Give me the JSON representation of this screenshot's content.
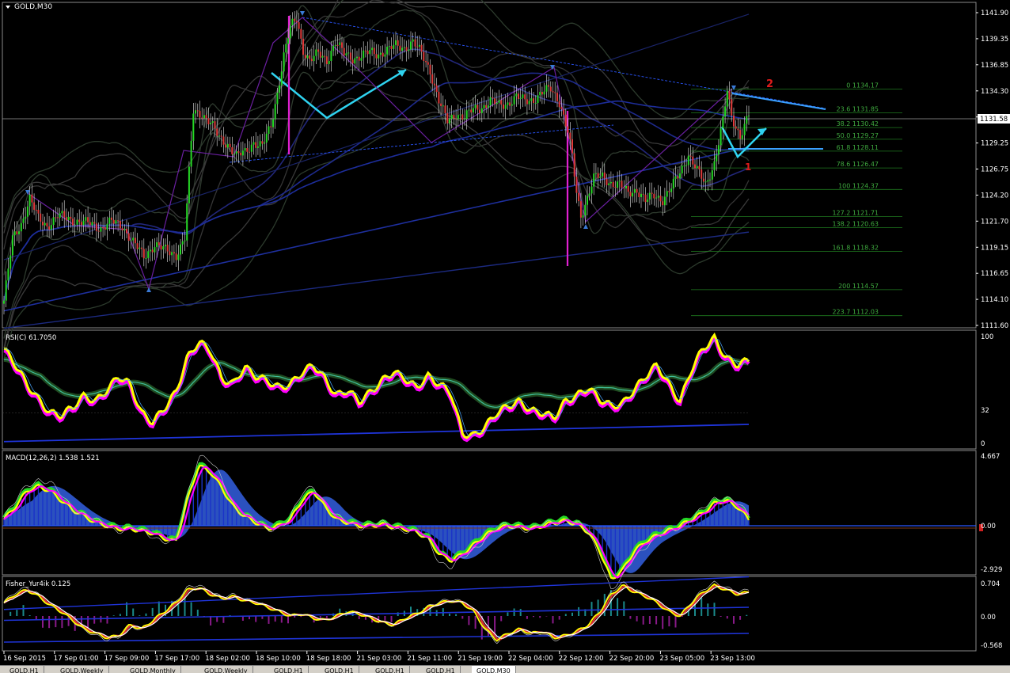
{
  "window": {
    "title": "GOLD,M30"
  },
  "colors": {
    "background": "#000000",
    "bull": "#26d926",
    "bear": "#e03a3a",
    "rsi_line": "#ffff00",
    "rsi_shadow": "#ff00ff",
    "macd_hist": "#1f3fd8",
    "macd_fill": "#3a6cff",
    "fibo": "#1f7a1f",
    "arrow": "#2fd3f0",
    "wave_label": "#e01b1b",
    "vertical_marker": "#e020d0"
  },
  "price_axis": {
    "ticks": [
      "1141.90",
      "1139.35",
      "1136.85",
      "1134.30",
      "1131.85",
      "1129.25",
      "1126.75",
      "1124.20",
      "1121.70",
      "1119.15",
      "1116.65",
      "1114.10",
      "1111.60"
    ],
    "current": "1131.58"
  },
  "time_axis": {
    "ticks": [
      "16 Sep 2015",
      "17 Sep 01:00",
      "17 Sep 09:00",
      "17 Sep 17:00",
      "18 Sep 02:00",
      "18 Sep 10:00",
      "18 Sep 18:00",
      "21 Sep 03:00",
      "21 Sep 11:00",
      "21 Sep 19:00",
      "22 Sep 04:00",
      "22 Sep 12:00",
      "22 Sep 20:00",
      "23 Sep 05:00",
      "23 Sep 13:00"
    ]
  },
  "fibo_levels": [
    {
      "label": "0 1134.17",
      "price": 1134.17
    },
    {
      "label": "23.6 1131.85",
      "price": 1131.85
    },
    {
      "label": "38.2 1130.42",
      "price": 1130.42
    },
    {
      "label": "50.0 1129.27",
      "price": 1129.27
    },
    {
      "label": "61.8 1128.11",
      "price": 1128.11
    },
    {
      "label": "78.6 1126.47",
      "price": 1126.47
    },
    {
      "label": "100 1124.37",
      "price": 1124.37
    },
    {
      "label": "127.2 1121.71",
      "price": 1121.71
    },
    {
      "label": "138.2 1120.63",
      "price": 1120.63
    },
    {
      "label": "161.8 1118.32",
      "price": 1118.32
    },
    {
      "label": "200 1114.57",
      "price": 1114.57
    },
    {
      "label": "223.7 1112.03",
      "price": 1112.03
    }
  ],
  "wave_labels": [
    "2",
    "1"
  ],
  "indicators": {
    "rsi": {
      "label": "RSI(C) 61.7050",
      "axis": [
        "100",
        "32",
        "0"
      ]
    },
    "macd": {
      "label": "MACD(12,26,2) 1.538 1.521",
      "axis": [
        "4.667",
        "0.00",
        "-2.929"
      ]
    },
    "sub4": {
      "label": "Fisher_Yur4ik 0.125",
      "axis": [
        "0.704",
        "0.00",
        "-0.568"
      ]
    }
  },
  "tabs": [
    "GOLD,H1",
    "GOLD,Weekly",
    "GOLD,Monthly",
    "GOLD,Weekly",
    "GOLD,H1",
    "GOLD,H1",
    "GOLD,H1",
    "GOLD,H1",
    "GOLD,M30"
  ],
  "active_tab": 8,
  "chart_data": {
    "type": "candlestick",
    "title": "GOLD,M30",
    "ylim": [
      1111.0,
      1142.5
    ],
    "x_ticks": [
      "16 Sep 2015",
      "17 Sep 01:00",
      "17 Sep 09:00",
      "17 Sep 17:00",
      "18 Sep 02:00",
      "18 Sep 10:00",
      "18 Sep 18:00",
      "21 Sep 03:00",
      "21 Sep 11:00",
      "21 Sep 19:00",
      "22 Sep 04:00",
      "22 Sep 12:00",
      "22 Sep 20:00",
      "23 Sep 05:00",
      "23 Sep 13:00"
    ],
    "price_path": [
      [
        0,
        1113.5
      ],
      [
        4,
        1119.5
      ],
      [
        8,
        1121.0
      ],
      [
        12,
        1123.5
      ],
      [
        16,
        1121.5
      ],
      [
        20,
        1120.8
      ],
      [
        25,
        1121.8
      ],
      [
        30,
        1121.5
      ],
      [
        35,
        1121.2
      ],
      [
        40,
        1121.0
      ],
      [
        45,
        1120.6
      ],
      [
        50,
        1121.2
      ],
      [
        55,
        1120.8
      ],
      [
        60,
        1119.2
      ],
      [
        65,
        1117.8
      ],
      [
        70,
        1119.0
      ],
      [
        75,
        1118.4
      ],
      [
        80,
        1118.0
      ],
      [
        84,
        1119.6
      ],
      [
        86,
        1126.0
      ],
      [
        88,
        1132.0
      ],
      [
        92,
        1131.8
      ],
      [
        96,
        1130.8
      ],
      [
        100,
        1129.4
      ],
      [
        104,
        1128.8
      ],
      [
        108,
        1127.6
      ],
      [
        112,
        1128.0
      ],
      [
        116,
        1129.0
      ],
      [
        120,
        1128.6
      ],
      [
        124,
        1130.5
      ],
      [
        127,
        1133.8
      ],
      [
        130,
        1137.5
      ],
      [
        133,
        1140.2
      ],
      [
        136,
        1141.0
      ],
      [
        139,
        1138.0
      ],
      [
        142,
        1137.0
      ],
      [
        146,
        1137.6
      ],
      [
        150,
        1137.0
      ],
      [
        154,
        1138.8
      ],
      [
        158,
        1137.6
      ],
      [
        162,
        1137.2
      ],
      [
        166,
        1137.4
      ],
      [
        170,
        1137.8
      ],
      [
        174,
        1137.6
      ],
      [
        178,
        1138.0
      ],
      [
        182,
        1138.4
      ],
      [
        186,
        1138.2
      ],
      [
        190,
        1138.8
      ],
      [
        194,
        1137.6
      ],
      [
        198,
        1136.0
      ],
      [
        202,
        1133.0
      ],
      [
        206,
        1131.0
      ],
      [
        210,
        1131.8
      ],
      [
        214,
        1131.4
      ],
      [
        218,
        1132.2
      ],
      [
        222,
        1132.4
      ],
      [
        226,
        1133.0
      ],
      [
        230,
        1132.6
      ],
      [
        234,
        1132.8
      ],
      [
        238,
        1133.4
      ],
      [
        242,
        1133.0
      ],
      [
        246,
        1133.2
      ],
      [
        250,
        1133.8
      ],
      [
        254,
        1134.2
      ],
      [
        258,
        1133.0
      ],
      [
        262,
        1130.0
      ],
      [
        264,
        1127.5
      ],
      [
        266,
        1124.0
      ],
      [
        268,
        1121.8
      ],
      [
        270,
        1123.0
      ],
      [
        274,
        1125.5
      ],
      [
        278,
        1125.6
      ],
      [
        282,
        1125.0
      ],
      [
        286,
        1124.8
      ],
      [
        290,
        1124.0
      ],
      [
        294,
        1124.4
      ],
      [
        298,
        1123.2
      ],
      [
        302,
        1123.8
      ],
      [
        306,
        1123.4
      ],
      [
        310,
        1124.5
      ],
      [
        314,
        1126.0
      ],
      [
        318,
        1127.8
      ],
      [
        322,
        1126.2
      ],
      [
        326,
        1124.8
      ],
      [
        330,
        1127.0
      ],
      [
        334,
        1131.0
      ],
      [
        336,
        1134.0
      ],
      [
        338,
        1131.5
      ],
      [
        342,
        1129.6
      ],
      [
        346,
        1131.6
      ]
    ],
    "series": [
      {
        "values": [
          0.86,
          0.72,
          0.55,
          0.42,
          0.3,
          0.28,
          0.35,
          0.45,
          0.4,
          0.5,
          0.62,
          0.55,
          0.3,
          0.22,
          0.34,
          0.48,
          0.78,
          0.92,
          0.85,
          0.6,
          0.55,
          0.7,
          0.62,
          0.58,
          0.52,
          0.55,
          0.65,
          0.72,
          0.6,
          0.45,
          0.5,
          0.4,
          0.48,
          0.58,
          0.66,
          0.6,
          0.52,
          0.62,
          0.55,
          0.48,
          0.12,
          0.1,
          0.18,
          0.3,
          0.36,
          0.4,
          0.32,
          0.3,
          0.26,
          0.4,
          0.45,
          0.52,
          0.42,
          0.36,
          0.38,
          0.5,
          0.62,
          0.72,
          0.55,
          0.4,
          0.68,
          0.86,
          0.95,
          0.78,
          0.72,
          0.76
        ]
      },
      {
        "values": [
          0.1,
          0.3,
          0.55,
          0.62,
          0.55,
          0.4,
          0.25,
          0.15,
          0.05,
          0.0,
          -0.05,
          -0.05,
          -0.08,
          -0.12,
          -0.2,
          -0.25,
          0.4,
          0.95,
          0.85,
          0.6,
          0.3,
          0.15,
          0.05,
          -0.05,
          0.0,
          0.1,
          0.4,
          0.55,
          0.3,
          0.1,
          0.05,
          0.0,
          0.0,
          0.02,
          -0.02,
          -0.05,
          -0.1,
          -0.2,
          -0.45,
          -0.55,
          -0.45,
          -0.3,
          -0.15,
          -0.05,
          0.0,
          -0.02,
          -0.05,
          0.0,
          0.05,
          0.08,
          0.02,
          -0.1,
          -0.4,
          -0.85,
          -0.7,
          -0.4,
          -0.25,
          -0.15,
          -0.08,
          0.0,
          0.1,
          0.2,
          0.35,
          0.4,
          0.3,
          0.1
        ]
      },
      {
        "values": [
          0.3,
          0.5,
          0.6,
          0.45,
          0.25,
          0.1,
          -0.1,
          -0.3,
          -0.4,
          -0.5,
          -0.45,
          -0.2,
          -0.3,
          -0.1,
          0.1,
          0.3,
          0.6,
          0.65,
          0.5,
          0.4,
          0.45,
          0.35,
          0.3,
          0.2,
          0.1,
          0.0,
          0.05,
          -0.05,
          -0.1,
          0.0,
          0.1,
          0.05,
          -0.05,
          -0.15,
          -0.2,
          -0.05,
          0.05,
          0.2,
          0.3,
          0.35,
          0.3,
          0.1,
          -0.3,
          -0.55,
          -0.4,
          -0.3,
          -0.4,
          -0.35,
          -0.5,
          -0.45,
          -0.35,
          -0.2,
          0.1,
          0.5,
          0.7,
          0.55,
          0.45,
          0.3,
          0.1,
          0.0,
          0.3,
          0.55,
          0.7,
          0.6,
          0.5,
          0.55
        ]
      }
    ]
  }
}
